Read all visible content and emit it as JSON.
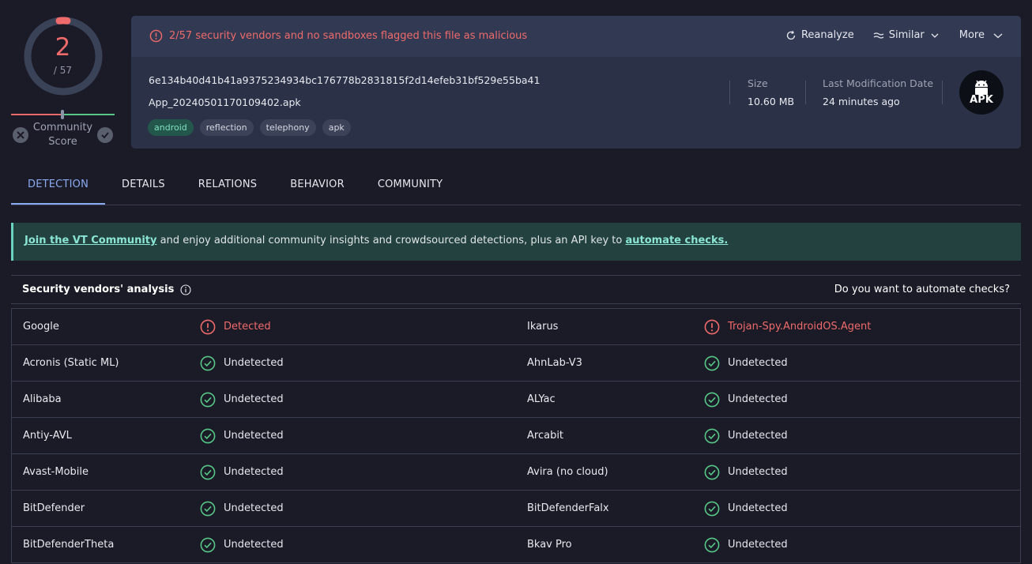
{
  "score": {
    "detected": "2",
    "total": "/ 57",
    "community_label": "Community Score"
  },
  "alert": {
    "text": "2/57 security vendors and no sandboxes flagged this file as malicious"
  },
  "actions": {
    "reanalyze": "Reanalyze",
    "similar": "Similar",
    "more": "More"
  },
  "file": {
    "hash": "6e134b40d41b41a9375234934bc176778b2831815f2d14efeb31bf529e55ba41",
    "name": "App_20240501170109402.apk",
    "tags": [
      "android",
      "reflection",
      "telephony",
      "apk"
    ],
    "size_label": "Size",
    "size_value": "10.60 MB",
    "mod_label": "Last Modification Date",
    "mod_value": "24 minutes ago",
    "type_badge": "APK"
  },
  "tabs": [
    "DETECTION",
    "DETAILS",
    "RELATIONS",
    "BEHAVIOR",
    "COMMUNITY"
  ],
  "banner": {
    "link1": "Join the VT Community",
    "middle": " and enjoy additional community insights and crowdsourced detections, plus an API key to ",
    "link2": "automate checks."
  },
  "analysis": {
    "title": "Security vendors' analysis",
    "automate": "Do you want to automate checks?"
  },
  "colors": {
    "malicious": "#ef6a6a",
    "clean": "#57c787",
    "accent": "#8aaaf0"
  },
  "vendors": [
    {
      "left": "Google",
      "left_result": "Detected",
      "left_status": "bad",
      "right": "Ikarus",
      "right_result": "Trojan-Spy.AndroidOS.Agent",
      "right_status": "bad"
    },
    {
      "left": "Acronis (Static ML)",
      "left_result": "Undetected",
      "left_status": "ok",
      "right": "AhnLab-V3",
      "right_result": "Undetected",
      "right_status": "ok"
    },
    {
      "left": "Alibaba",
      "left_result": "Undetected",
      "left_status": "ok",
      "right": "ALYac",
      "right_result": "Undetected",
      "right_status": "ok"
    },
    {
      "left": "Antiy-AVL",
      "left_result": "Undetected",
      "left_status": "ok",
      "right": "Arcabit",
      "right_result": "Undetected",
      "right_status": "ok"
    },
    {
      "left": "Avast-Mobile",
      "left_result": "Undetected",
      "left_status": "ok",
      "right": "Avira (no cloud)",
      "right_result": "Undetected",
      "right_status": "ok"
    },
    {
      "left": "BitDefender",
      "left_result": "Undetected",
      "left_status": "ok",
      "right": "BitDefenderFalx",
      "right_result": "Undetected",
      "right_status": "ok"
    },
    {
      "left": "BitDefenderTheta",
      "left_result": "Undetected",
      "left_status": "ok",
      "right": "Bkav Pro",
      "right_result": "Undetected",
      "right_status": "ok"
    }
  ]
}
